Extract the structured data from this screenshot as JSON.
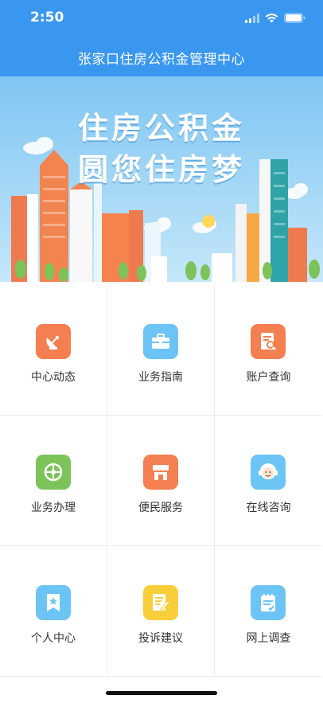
{
  "status_bar": {
    "time": "2:50"
  },
  "header": {
    "title": "张家口住房公积金管理中心"
  },
  "banner": {
    "slogan_line1": "住房公积金",
    "slogan_line2": "圆您住房梦"
  },
  "menu": {
    "items": [
      {
        "label": "中心动态",
        "icon": "satellite-dish-icon",
        "color": "#f47f50"
      },
      {
        "label": "业务指南",
        "icon": "briefcase-icon",
        "color": "#6cc4f5"
      },
      {
        "label": "账户查询",
        "icon": "document-search-icon",
        "color": "#f47f50"
      },
      {
        "label": "业务办理",
        "icon": "compass-icon",
        "color": "#7cc35a"
      },
      {
        "label": "便民服务",
        "icon": "shop-icon",
        "color": "#f47f50"
      },
      {
        "label": "在线咨询",
        "icon": "customer-service-icon",
        "color": "#6cc4f5"
      },
      {
        "label": "个人中心",
        "icon": "bookmark-star-icon",
        "color": "#6cc4f5"
      },
      {
        "label": "投诉建议",
        "icon": "edit-document-icon",
        "color": "#f8cf3a"
      },
      {
        "label": "网上调查",
        "icon": "survey-notepad-icon",
        "color": "#6cc4f5"
      }
    ]
  }
}
